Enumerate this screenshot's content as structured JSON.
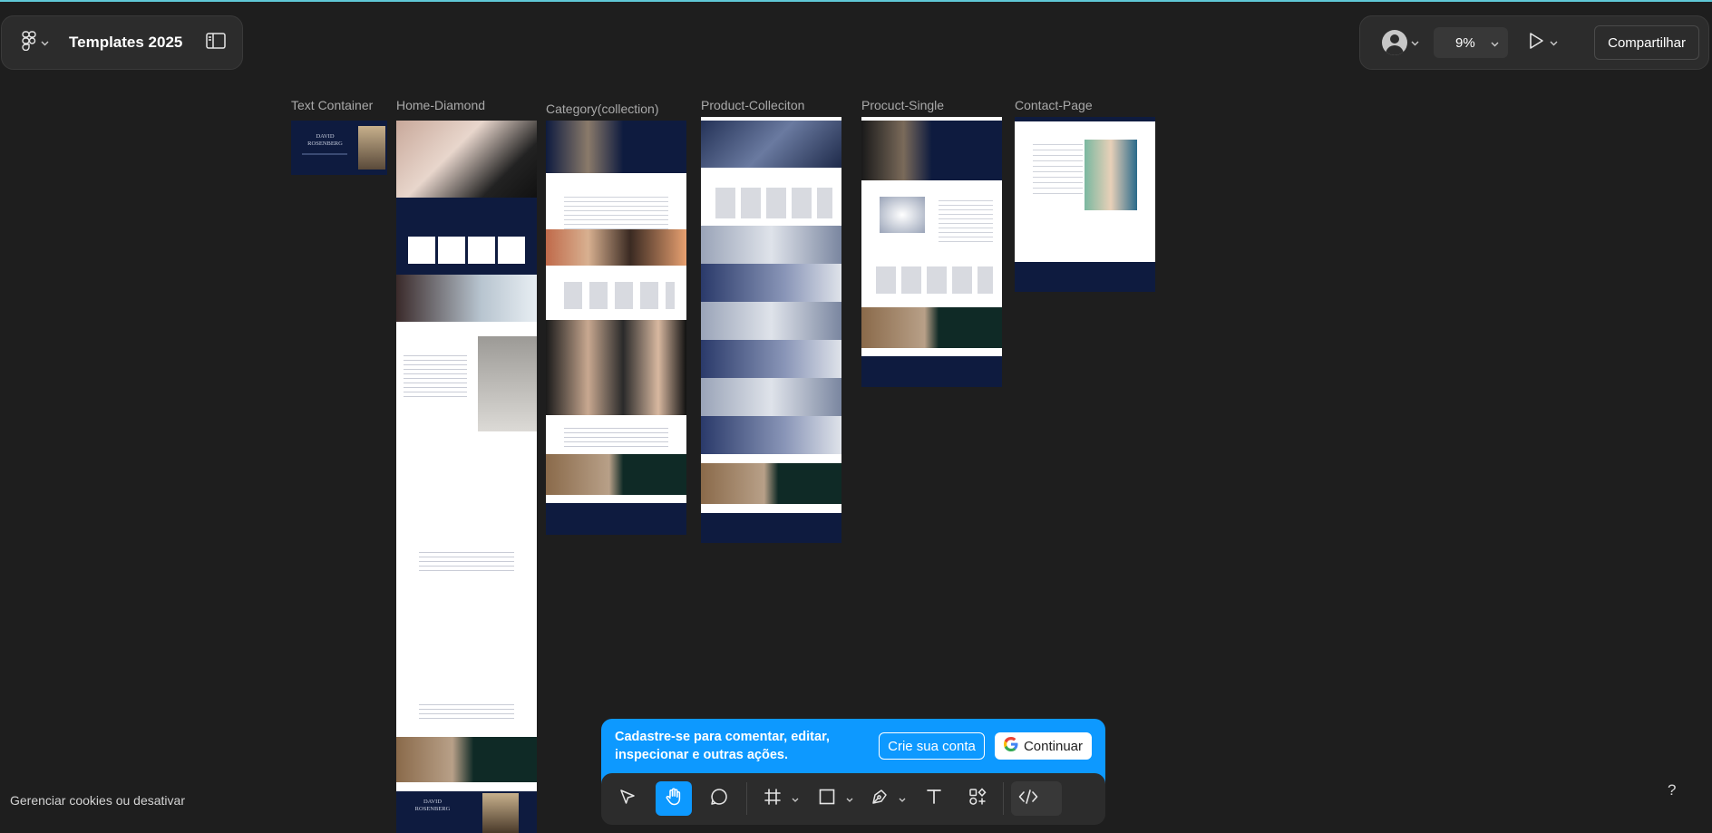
{
  "header": {
    "file_title": "Templates 2025",
    "zoom": "9%",
    "share_label": "Compartilhar"
  },
  "frames": [
    {
      "label": "Text Container"
    },
    {
      "label": "Home-Diamond"
    },
    {
      "label": "Category(collection)"
    },
    {
      "label": "Product-Colleciton"
    },
    {
      "label": "Procuct-Single"
    },
    {
      "label": "Contact-Page"
    }
  ],
  "thumbnail_text": {
    "brand_line1": "DAVID",
    "brand_line2": "ROSENBERG"
  },
  "signup_banner": {
    "text": "Cadastre-se para comentar, editar, inspecionar e outras ações.",
    "create_label": "Crie sua conta",
    "continue_label": "Continuar"
  },
  "footer": {
    "cookie_text": "Gerenciar cookies ou desativar",
    "help_label": "?"
  },
  "colors": {
    "canvas": "#1e1e1e",
    "panel": "#2c2c2c",
    "accent": "#0d99ff",
    "thumbnail_navy": "#0e1b3f"
  },
  "toolbar_tools": [
    "move-tool",
    "hand-tool",
    "comment-tool",
    "frame-tool",
    "shape-tool",
    "pen-tool",
    "text-tool",
    "resources-tool",
    "dev-mode-toggle"
  ]
}
